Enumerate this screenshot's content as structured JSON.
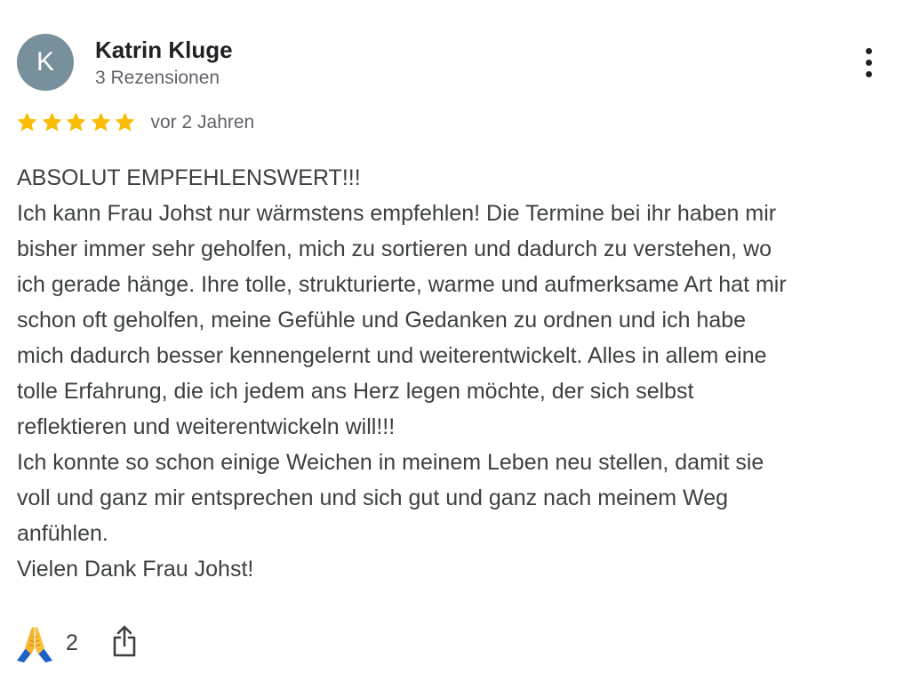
{
  "review": {
    "author": {
      "initial": "K",
      "name": "Katrin Kluge",
      "meta": "3 Rezensionen",
      "avatar_color": "#78909c"
    },
    "rating": {
      "stars": 5,
      "max": 5,
      "star_color": "#fbbc04"
    },
    "date": "vor 2 Jahren",
    "text": "ABSOLUT EMPFEHLENSWERT!!!\nIch kann Frau Johst nur wärmstens empfehlen! Die Termine bei ihr haben mir\nbisher immer sehr geholfen, mich zu sortieren und dadurch zu verstehen, wo\nich gerade hänge. Ihre tolle, strukturierte, warme und aufmerksame Art hat mir\nschon oft geholfen, meine Gefühle und Gedanken zu ordnen und ich habe\nmich dadurch besser kennengelernt und weiterentwickelt. Alles in allem eine\ntolle Erfahrung, die ich jedem ans Herz legen möchte, der sich selbst\nreflektieren und weiterentwickeln will!!!\nIch konnte so schon einige Weichen in meinem Leben neu stellen, damit sie\nvoll und ganz mir entsprechen und sich gut und ganz nach meinem Weg\nanfühlen.\nVielen Dank Frau Johst!",
    "actions": {
      "reaction_icon": "folded-hands-icon",
      "reaction_count": "2",
      "share_icon": "share-icon",
      "more_icon": "more-vert-icon"
    }
  }
}
